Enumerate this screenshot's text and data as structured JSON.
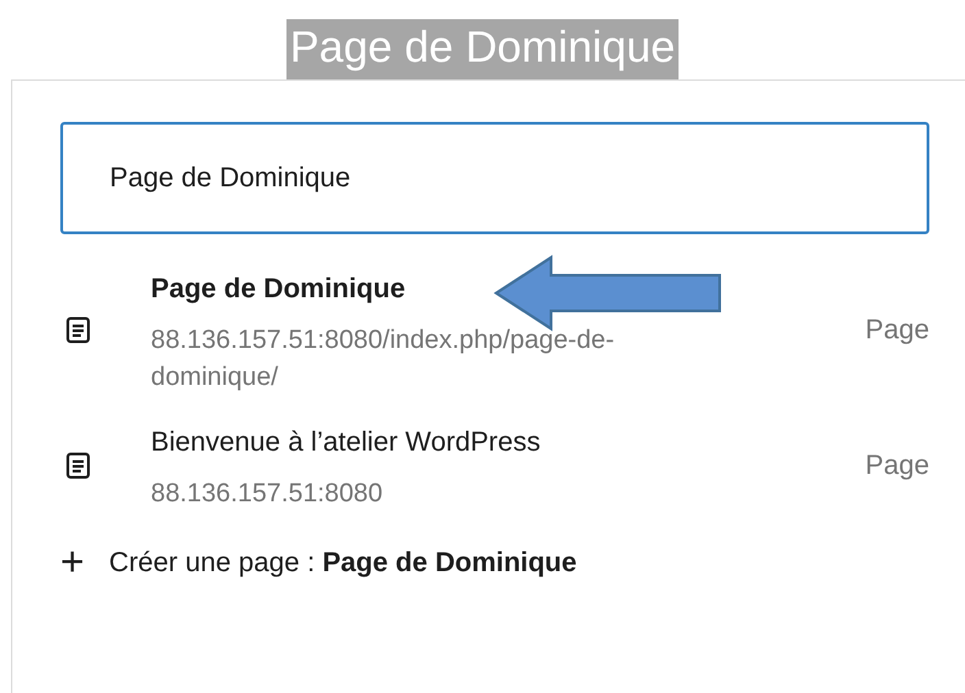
{
  "title": "Page de Dominique",
  "search": {
    "value": "Page de Dominique"
  },
  "results": [
    {
      "title": "Page de Dominique",
      "url": "88.136.157.51:8080/index.php/page-de-dominique/",
      "type": "Page",
      "bold": true
    },
    {
      "title": "Bienvenue à l’atelier WordPress",
      "url": "88.136.157.51:8080",
      "type": "Page",
      "bold": false
    }
  ],
  "create": {
    "icon": "+",
    "label": "Créer une page : **Page de Dominique**"
  }
}
